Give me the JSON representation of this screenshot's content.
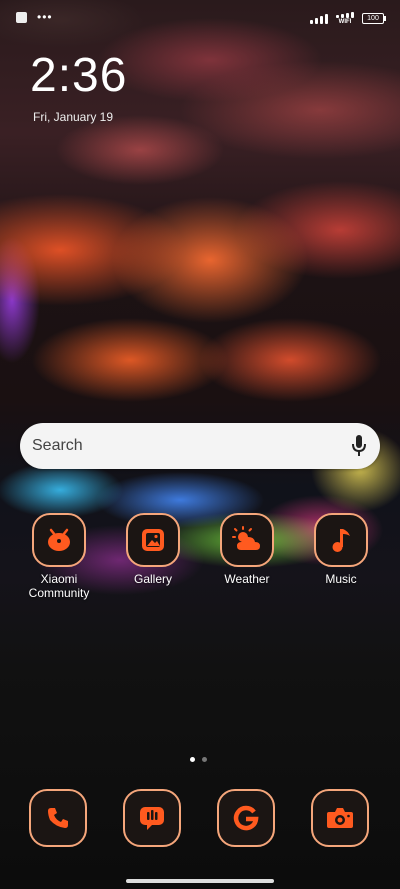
{
  "status_bar": {
    "wifi_label": "WIFI",
    "battery": "100"
  },
  "lock": {
    "time": "2:36",
    "date": "Fri, January 19"
  },
  "search": {
    "placeholder": "Search"
  },
  "apps": [
    {
      "label_line1": "Xiaomi",
      "label_line2": "Community",
      "icon": "xiaomi-community-icon"
    },
    {
      "label_line1": "Gallery",
      "icon": "gallery-icon"
    },
    {
      "label_line1": "Weather",
      "icon": "weather-icon"
    },
    {
      "label_line1": "Music",
      "icon": "music-icon"
    }
  ],
  "dock": [
    {
      "icon": "phone-icon"
    },
    {
      "icon": "messages-icon"
    },
    {
      "icon": "google-icon"
    },
    {
      "icon": "camera-icon"
    }
  ],
  "page_indicator": {
    "pages": 2,
    "current": 1
  },
  "colors": {
    "accent": "#ff5a1f",
    "icon_border": "#f5a67b",
    "icon_bg": "#1b1513"
  }
}
